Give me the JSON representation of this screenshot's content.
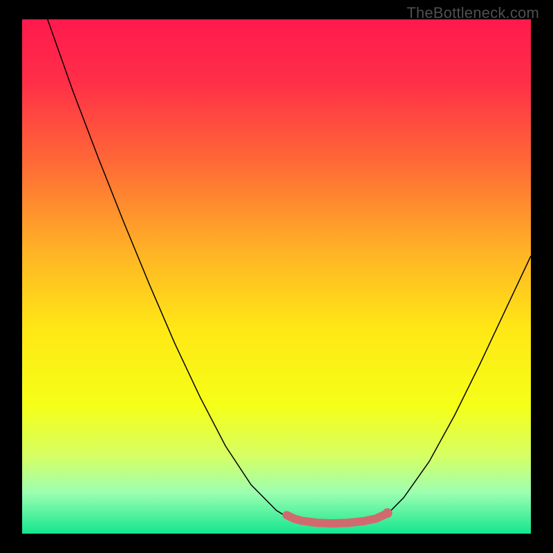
{
  "watermark": "TheBottleneck.com",
  "chart_data": {
    "type": "line",
    "title": "",
    "xlabel": "",
    "ylabel": "",
    "xlim": [
      0,
      100
    ],
    "ylim": [
      0,
      100
    ],
    "background_gradient": {
      "stops": [
        {
          "offset": 0.0,
          "color": "#ff1a4d"
        },
        {
          "offset": 0.12,
          "color": "#ff2e48"
        },
        {
          "offset": 0.28,
          "color": "#ff6a36"
        },
        {
          "offset": 0.45,
          "color": "#ffb226"
        },
        {
          "offset": 0.6,
          "color": "#ffe715"
        },
        {
          "offset": 0.75,
          "color": "#f5ff17"
        },
        {
          "offset": 0.85,
          "color": "#d5ff65"
        },
        {
          "offset": 0.92,
          "color": "#9dffb1"
        },
        {
          "offset": 1.0,
          "color": "#14e58f"
        }
      ]
    },
    "series": [
      {
        "name": "bottleneck-curve",
        "stroke": "#000000",
        "stroke_width": 1.5,
        "points": [
          {
            "x": 5.0,
            "y": 100.0
          },
          {
            "x": 10.0,
            "y": 86.0
          },
          {
            "x": 15.0,
            "y": 73.0
          },
          {
            "x": 20.0,
            "y": 60.5
          },
          {
            "x": 25.0,
            "y": 48.5
          },
          {
            "x": 30.0,
            "y": 37.0
          },
          {
            "x": 35.0,
            "y": 26.5
          },
          {
            "x": 40.0,
            "y": 17.0
          },
          {
            "x": 45.0,
            "y": 9.5
          },
          {
            "x": 50.0,
            "y": 4.5
          },
          {
            "x": 52.5,
            "y": 3.0
          },
          {
            "x": 55.0,
            "y": 2.3
          },
          {
            "x": 60.0,
            "y": 2.0
          },
          {
            "x": 65.0,
            "y": 2.2
          },
          {
            "x": 70.0,
            "y": 3.1
          },
          {
            "x": 72.5,
            "y": 4.5
          },
          {
            "x": 75.0,
            "y": 7.0
          },
          {
            "x": 80.0,
            "y": 14.0
          },
          {
            "x": 85.0,
            "y": 23.0
          },
          {
            "x": 90.0,
            "y": 33.0
          },
          {
            "x": 95.0,
            "y": 43.5
          },
          {
            "x": 100.0,
            "y": 54.0
          }
        ]
      },
      {
        "name": "optimal-zone-marker",
        "stroke": "#d16a6f",
        "stroke_width": 12,
        "linecap": "round",
        "points": [
          {
            "x": 52.0,
            "y": 3.6
          },
          {
            "x": 53.5,
            "y": 2.9
          },
          {
            "x": 55.0,
            "y": 2.5
          },
          {
            "x": 58.0,
            "y": 2.1
          },
          {
            "x": 61.0,
            "y": 2.0
          },
          {
            "x": 64.0,
            "y": 2.1
          },
          {
            "x": 67.0,
            "y": 2.4
          },
          {
            "x": 69.5,
            "y": 2.9
          },
          {
            "x": 71.5,
            "y": 3.8
          }
        ],
        "end_dots": [
          {
            "x": 71.8,
            "y": 4.0,
            "r": 7
          }
        ]
      }
    ]
  }
}
